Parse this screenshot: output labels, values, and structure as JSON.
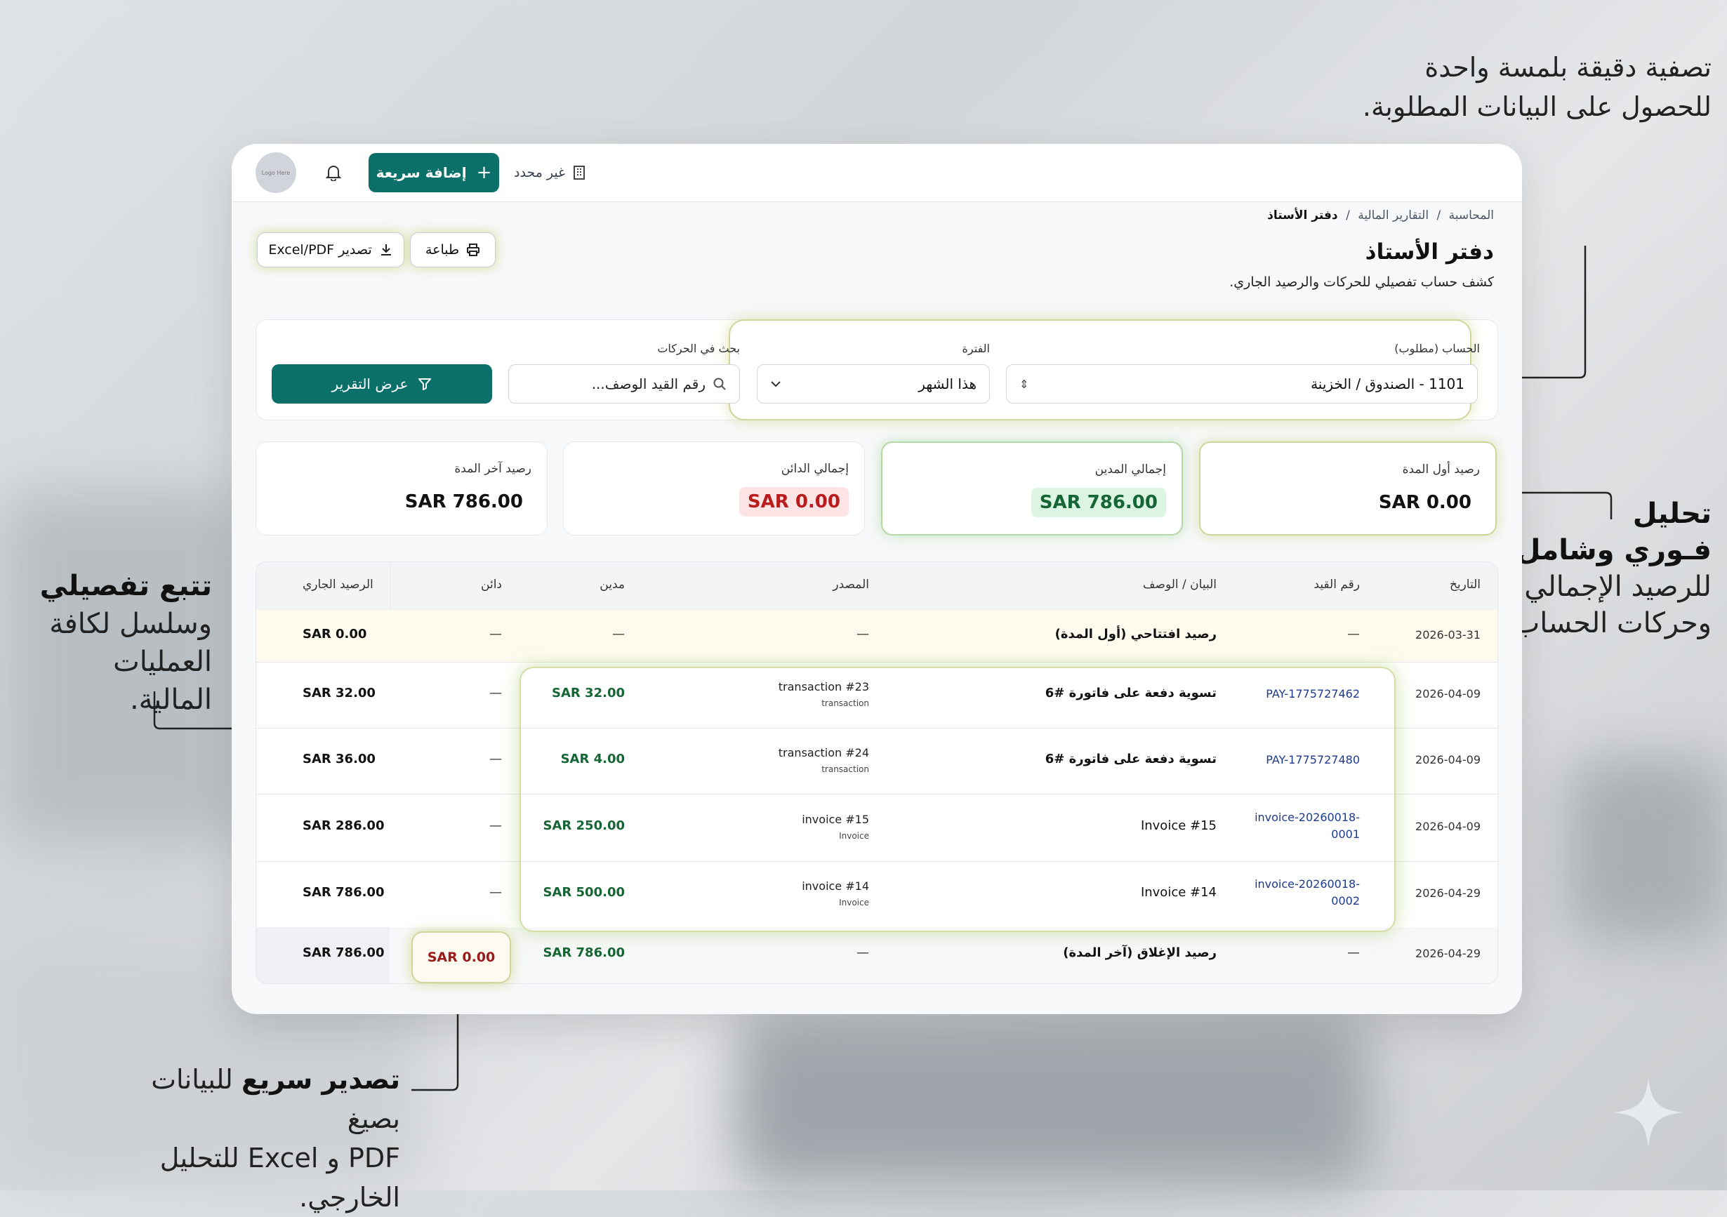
{
  "annotations": {
    "top_right": [
      "تصفية دقيقة بلمسة واحدة",
      "للحصول على البيانات المطلوبة."
    ],
    "right_bold": [
      "تحليل",
      "فـوري وشامل"
    ],
    "right_rest": [
      "للرصيد الإجمالي",
      "وحركات الحساب."
    ],
    "left_bold": "تتبع تفصيلي",
    "left_rest": [
      "وسلسل لكافة",
      "العمليات المالية."
    ],
    "bottom_bold": "تصدير سريع",
    "bottom_line1_rest": " للبيانات بصيغ",
    "bottom_line2": "PDF و Excel للتحليل الخارجي."
  },
  "topbar": {
    "avatar_text": "Logo Here",
    "quick_add": "إضافة سريعة",
    "company": "غير محدد"
  },
  "breadcrumb": {
    "item1": "المحاسبة",
    "item2": "التقارير المالية",
    "current": "دفتر الأستاذ",
    "sep": "/"
  },
  "page": {
    "title": "دفتر الأستاذ",
    "subtitle": "كشف حساب تفصيلي للحركات والرصيد الجاري."
  },
  "actions": {
    "print": "طباعة",
    "export": "تصدير Excel/PDF"
  },
  "filters": {
    "account_label": "الحساب (مطلوب)",
    "account_value": "1101 - الصندوق / الخزينة",
    "period_label": "الفترة",
    "period_value": "هذا الشهر",
    "search_label": "بحث في الحركات",
    "search_placeholder": "رقم القيد الوصف...",
    "show_report": "عرض التقرير"
  },
  "stats": [
    {
      "label": "رصيد أول المدة",
      "value": "SAR 0.00"
    },
    {
      "label": "إجمالي المدين",
      "value": "SAR 786.00"
    },
    {
      "label": "إجمالي الدائن",
      "value": "SAR 0.00"
    },
    {
      "label": "رصيد آخر المدة",
      "value": "SAR 786.00"
    }
  ],
  "table": {
    "headers": {
      "date": "التاريخ",
      "entry": "رقم القيد",
      "desc": "البيان / الوصف",
      "source": "المصدر",
      "debit": "مدين",
      "credit": "دائن",
      "balance": "الرصيد الجاري"
    },
    "opening": {
      "date": "2026-03-31",
      "entry": "—",
      "desc": "رصيد افتتاحي (أول المدة)",
      "source": "—",
      "debit": "—",
      "credit": "—",
      "balance": "SAR 0.00"
    },
    "rows": [
      {
        "date": "2026-04-09",
        "entry": "PAY-1775727462",
        "entry2": "",
        "desc": "تسوية دفعة على فاتورة #6",
        "source": "transaction #23",
        "source_type": "transaction",
        "debit": "SAR 32.00",
        "credit": "—",
        "balance": "SAR 32.00"
      },
      {
        "date": "2026-04-09",
        "entry": "PAY-1775727480",
        "entry2": "",
        "desc": "تسوية دفعة على فاتورة #6",
        "source": "transaction #24",
        "source_type": "transaction",
        "debit": "SAR 4.00",
        "credit": "—",
        "balance": "SAR 36.00"
      },
      {
        "date": "2026-04-09",
        "entry": "invoice-20260018-",
        "entry2": "0001",
        "desc": "Invoice #15",
        "source": "invoice #15",
        "source_type": "Invoice",
        "debit": "SAR 250.00",
        "credit": "—",
        "balance": "SAR 286.00"
      },
      {
        "date": "2026-04-29",
        "entry": "invoice-20260018-",
        "entry2": "0002",
        "desc": "Invoice #14",
        "source": "invoice #14",
        "source_type": "Invoice",
        "debit": "SAR 500.00",
        "credit": "—",
        "balance": "SAR 786.00"
      }
    ],
    "closing": {
      "date": "2026-04-29",
      "entry": "—",
      "desc": "رصيد الإغلاق (آخر المدة)",
      "source": "—",
      "debit": "SAR 786.00",
      "credit": "SAR 0.00",
      "balance": "SAR 786.00"
    }
  },
  "colors": {
    "primary": "#0b6f6a",
    "debit": "#166534",
    "credit": "#991b1b",
    "link": "#1e3a8a"
  }
}
